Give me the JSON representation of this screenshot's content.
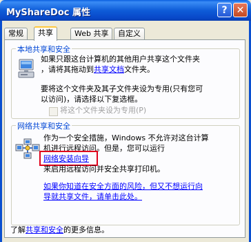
{
  "window": {
    "title": "MyShareDoc 属性",
    "help_glyph": "?",
    "close_glyph": "✕"
  },
  "tabs": [
    {
      "label": "常规",
      "active": false
    },
    {
      "label": "共享",
      "active": true
    },
    {
      "label": "Web 共享",
      "active": false
    },
    {
      "label": "自定义",
      "active": false
    }
  ],
  "local_sharing": {
    "group_title": "本地共享和安全",
    "line1": "如果只跟这台计算机的其他用户共享这个文件夹",
    "line2_prefix": "，请将其拖动到",
    "line2_link": "共享文档",
    "line2_suffix": "文件夹。",
    "line3": "要将这个文件夹及其子文件夹设为专用(只有您可",
    "line4": "以访问)，请选择以下复选框。",
    "checkbox_label": "将这个文件夹设为专用(P)",
    "checkbox_checked": false,
    "checkbox_enabled": false
  },
  "network_sharing": {
    "group_title": "网络共享和安全",
    "line1": "作为一个安全措施，Windows 不允许对这台计算",
    "line2": "机进行远程访问。但是，您可以运行",
    "wizard_link": "网络安装向导",
    "line3": "来启用远程访问并安全共享打印机。",
    "risk_line1": "如果你知道在安全方面的风险，但又不想运行向",
    "risk_line2": "导就共享文件，请单击此处。"
  },
  "footer": {
    "prefix": "了解",
    "link": "共享和安全",
    "suffix": "的更多信息。"
  },
  "colors": {
    "titlebar": "#0A5FE0",
    "group_title": "#0046D5",
    "link": "#0000FF",
    "highlight": "#E0001B",
    "tab_accent": "#FFC83C"
  }
}
